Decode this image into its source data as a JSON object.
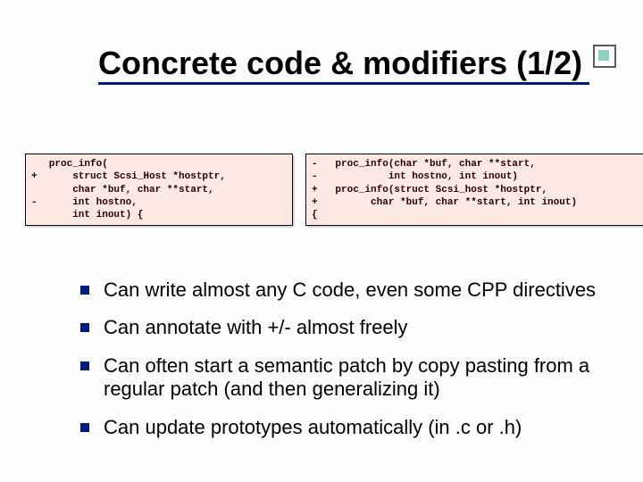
{
  "title": "Concrete code & modifiers (1/2)",
  "code_left": "   proc_info(\n+      struct Scsi_Host *hostptr,\n       char *buf, char **start,\n-      int hostno,\n       int inout) {",
  "code_right": "-   proc_info(char *buf, char **start,\n-            int hostno, int inout)\n+   proc_info(struct Scsi_host *hostptr,\n+         char *buf, char **start, int inout)\n{",
  "bullets": {
    "b1": "Can write almost any C code, even some CPP directives",
    "b2": "Can annotate with +/- almost freely",
    "b3": "Can often start a semantic patch by copy pasting from a regular patch (and then generalizing it)",
    "b4": "Can update prototypes automatically (in .c or .h)"
  }
}
